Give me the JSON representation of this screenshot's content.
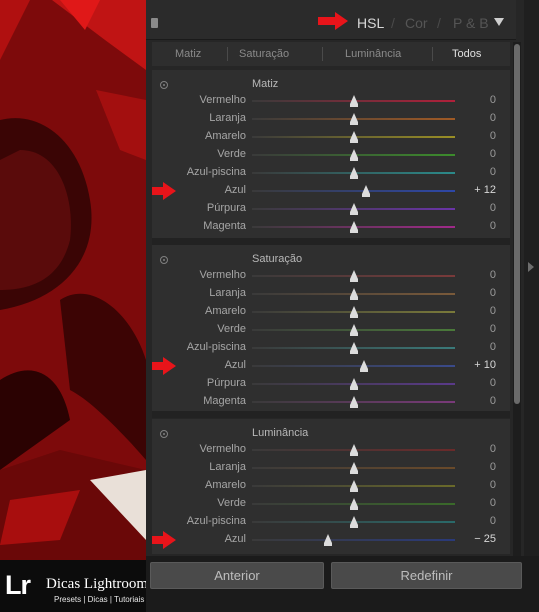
{
  "header": {
    "tabs": [
      {
        "label": "HSL",
        "active": true
      },
      {
        "label": "Cor",
        "active": false
      },
      {
        "label": "P & B",
        "active": false
      }
    ],
    "separator": "/"
  },
  "subtabs": [
    {
      "label": "Matiz",
      "active": false
    },
    {
      "label": "Saturação",
      "active": false
    },
    {
      "label": "Luminância",
      "active": false
    },
    {
      "label": "Todos",
      "active": true
    }
  ],
  "sections": {
    "matiz": {
      "title": "Matiz",
      "rows": [
        {
          "label": "Vermelho",
          "value": "0",
          "level": 0
        },
        {
          "label": "Laranja",
          "value": "0",
          "level": 0
        },
        {
          "label": "Amarelo",
          "value": "0",
          "level": 0
        },
        {
          "label": "Verde",
          "value": "0",
          "level": 0
        },
        {
          "label": "Azul-piscina",
          "value": "0",
          "level": 0
        },
        {
          "label": "Azul",
          "value": "+ 12",
          "level": 12
        },
        {
          "label": "Púrpura",
          "value": "0",
          "level": 0
        },
        {
          "label": "Magenta",
          "value": "0",
          "level": 0
        }
      ]
    },
    "saturacao": {
      "title": "Saturação",
      "rows": [
        {
          "label": "Vermelho",
          "value": "0",
          "level": 0
        },
        {
          "label": "Laranja",
          "value": "0",
          "level": 0
        },
        {
          "label": "Amarelo",
          "value": "0",
          "level": 0
        },
        {
          "label": "Verde",
          "value": "0",
          "level": 0
        },
        {
          "label": "Azul-piscina",
          "value": "0",
          "level": 0
        },
        {
          "label": "Azul",
          "value": "+ 10",
          "level": 10
        },
        {
          "label": "Púrpura",
          "value": "0",
          "level": 0
        },
        {
          "label": "Magenta",
          "value": "0",
          "level": 0
        }
      ]
    },
    "luminancia": {
      "title": "Luminância",
      "rows": [
        {
          "label": "Vermelho",
          "value": "0",
          "level": 0
        },
        {
          "label": "Laranja",
          "value": "0",
          "level": 0
        },
        {
          "label": "Amarelo",
          "value": "0",
          "level": 0
        },
        {
          "label": "Verde",
          "value": "0",
          "level": 0
        },
        {
          "label": "Azul-piscina",
          "value": "0",
          "level": 0
        },
        {
          "label": "Azul",
          "value": "− 25",
          "level": -25
        }
      ]
    }
  },
  "footer": {
    "previous_label": "Anterior",
    "reset_label": "Redefinir"
  },
  "branding": {
    "logo_letters": "Lr",
    "title": "Dicas Lightroom",
    "subtitle": "Presets | Dicas | Tutoriais"
  },
  "colors": {
    "arrow": "#e8141a",
    "track_hue": [
      "#b0203a",
      "#a05a25",
      "#9a8f25",
      "#3c8c2c",
      "#2b8a8a",
      "#2d47a8",
      "#6a34a8",
      "#a02a8a"
    ],
    "track_sat": [
      "#7a3a3a",
      "#7a5a3a",
      "#7a7a3a",
      "#4a7a3a",
      "#3a7a7a",
      "#3a4a8a",
      "#5a3a8a",
      "#7a3a7a"
    ],
    "track_lum": [
      "#6a2a2a",
      "#6a4a2a",
      "#6a6a2a",
      "#3a6a2a",
      "#2a6a6a",
      "#2a3a7a"
    ]
  },
  "icons": [
    "panel-collapse-handle-icon",
    "dropdown-triangle-icon",
    "section-toggle-icon",
    "red-arrow-icon",
    "side-panel-arrow-icon"
  ]
}
